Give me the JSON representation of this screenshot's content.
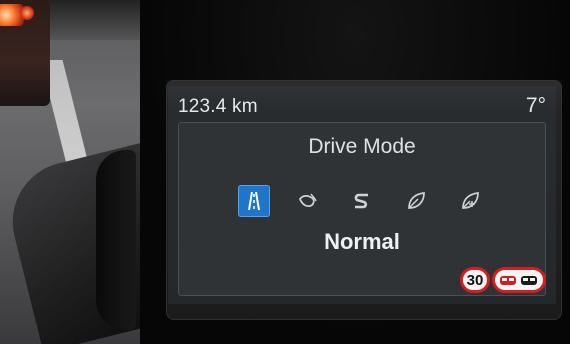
{
  "cluster": {
    "odometer": "123.4 km",
    "temperature": "7°"
  },
  "drive_mode": {
    "title": "Drive Mode",
    "current": "Normal",
    "modes": [
      {
        "icon": "road-normal-icon",
        "active": true
      },
      {
        "icon": "eco-drop-icon",
        "active": false
      },
      {
        "icon": "sport-s-icon",
        "active": false
      },
      {
        "icon": "leaf-icon",
        "active": false
      },
      {
        "icon": "leaf-plus-icon",
        "active": false
      }
    ],
    "accent_color": "#1f75c8"
  },
  "traffic_signs": {
    "speed_limit": "30",
    "no_overtaking": "no-overtaking-icon",
    "sign_color": "#d21e1e"
  }
}
